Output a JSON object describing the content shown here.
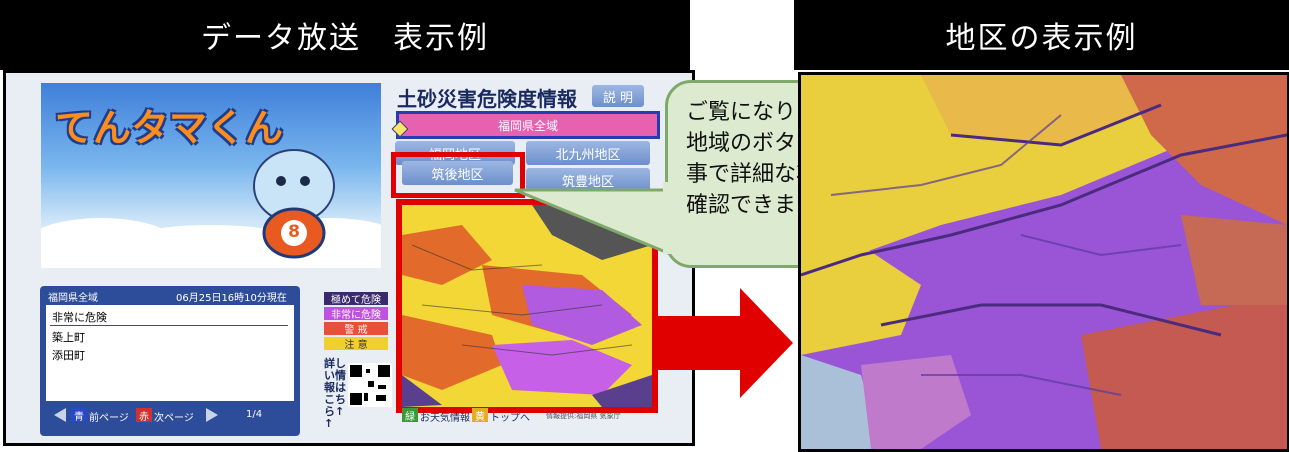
{
  "headers": {
    "left": "データ放送　表示例",
    "right": "地区の表示例"
  },
  "tv": {
    "title": "土砂災害危険度情報",
    "explain_button": "説 明",
    "area_buttons": [
      "福岡県全域",
      "福岡地区",
      "北九州地区",
      "筑後地区",
      "筑豊地区"
    ],
    "mascot_name": "てんタマくん",
    "mascot_badge": "8",
    "list_panel": {
      "region": "福岡県全域",
      "timestamp": "06月25日16時10分現在",
      "category": "非常に危険",
      "items": [
        "築上町",
        "添田町"
      ]
    },
    "legend": [
      {
        "label": "極めて危険",
        "color": "#3b2a6b"
      },
      {
        "label": "非常に危険",
        "color": "#c050e0"
      },
      {
        "label": "警 戒",
        "color": "#e8503a"
      },
      {
        "label": "注 意",
        "color": "#f0d030"
      }
    ],
    "qr_caption": "詳しい情報はこちら↑↑",
    "footer": {
      "blue_key": "青",
      "prev_label": "前ページ",
      "red_key": "赤",
      "next_label": "次ページ",
      "page": "1/4",
      "green_key": "緑",
      "weather_label": "お天気情報",
      "yellow_key": "黄",
      "top_label": "トップへ",
      "credit": "情報提供:福岡県 気象庁"
    }
  },
  "bubble_lines": [
    "ご覧になりたい",
    "地域のボタンを押す",
    "事で詳細な状況を",
    "確認できます"
  ],
  "colors": {
    "highlight": "#e00000",
    "arrow": "#e00000",
    "bubble_fill": "#dcebd0",
    "bubble_border": "#7fa86b"
  }
}
